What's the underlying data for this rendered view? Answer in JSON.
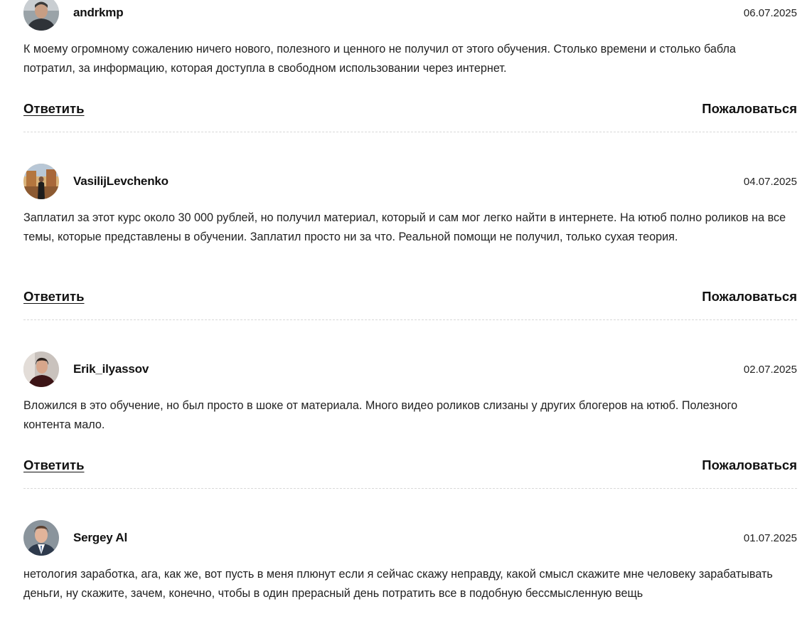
{
  "reviews": [
    {
      "username": "andrkmp",
      "date": "06.07.2025",
      "text": "К моему огромному сожалению ничего нового, полезного и ценного не получил от этого обучения. Столько времени и столько бабла потратил, за информацию, которая доступла в свободном использовании через интернет.",
      "reply_label": "Ответить",
      "complain_label": "Пожаловаться"
    },
    {
      "username": "VasilijLevchenko",
      "date": "04.07.2025",
      "text": "Заплатил за этот курс около 30 000 рублей, но получил материал, который и сам мог легко найти в интернете. На ютюб полно роликов на все темы, которые представлены в обучении. Заплатил просто ни за что. Реальной помощи не получил, только сухая теория.",
      "reply_label": "Ответить",
      "complain_label": "Пожаловаться"
    },
    {
      "username": "Erik_ilyassov",
      "date": "02.07.2025",
      "text": "Вложился в это обучение, но был просто в шоке от материала. Много видео роликов слизаны у других блогеров на ютюб. Полезного контента мало.",
      "reply_label": "Ответить",
      "complain_label": "Пожаловаться"
    },
    {
      "username": "Sergey Al",
      "date": "01.07.2025",
      "text": "нетология заработка, ага, как же, вот пусть в меня плюнут если я сейчас скажу неправду, какой смысл скажите мне человеку зарабатывать деньги, ну скажите, зачем, конечно, чтобы в один прерасный день потратить все в подобную бессмысленную вещь"
    }
  ]
}
